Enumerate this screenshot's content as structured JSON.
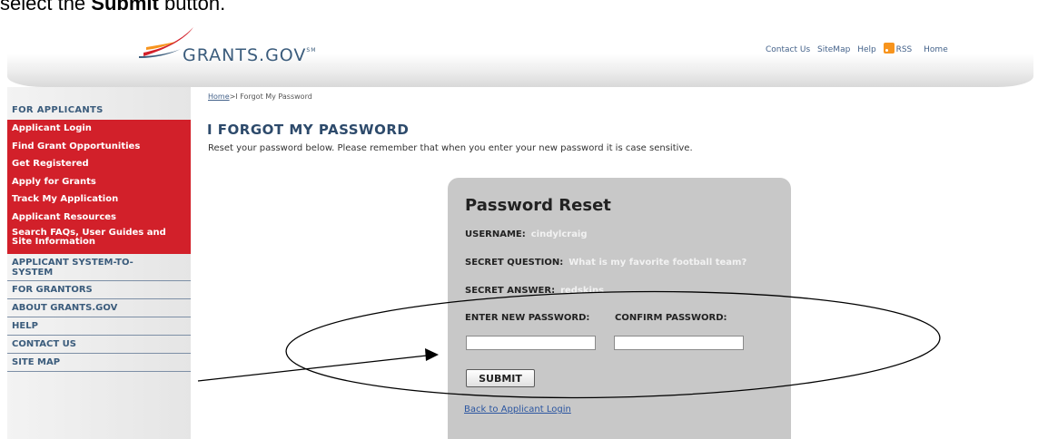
{
  "caption": {
    "prefix": "select the ",
    "bold": "Submit",
    "suffix": " button."
  },
  "header": {
    "logo_text": "GRANTS.GOV",
    "logo_mark": "SM",
    "toplinks": {
      "contact": "Contact Us",
      "sitemap": "SiteMap",
      "help": "Help",
      "rss": "RSS",
      "home": "Home"
    }
  },
  "sidebar": {
    "heading": "FOR APPLICANTS",
    "red_items": [
      "Applicant Login",
      "Find Grant Opportunities",
      "Get Registered",
      "Apply for Grants",
      "Track My Application",
      "Applicant Resources",
      "Search FAQs, User Guides and",
      "Site Information"
    ],
    "gray_items": [
      "APPLICANT SYSTEM-TO-",
      "SYSTEM",
      "FOR GRANTORS",
      "ABOUT GRANTS.GOV",
      "HELP",
      "CONTACT US",
      "SITE MAP"
    ]
  },
  "breadcrumb": {
    "home": "Home",
    "separator": ">",
    "current": "I Forgot My Password"
  },
  "page": {
    "title": "I FORGOT MY PASSWORD",
    "intro": "Reset your password below. Please remember that when you enter your new password it is case sensitive."
  },
  "form": {
    "title": "Password Reset",
    "username_label": "USERNAME:",
    "username_value": "cindylcraig",
    "question_label": "SECRET QUESTION:",
    "question_value": "What is my favorite football team?",
    "answer_label": "SECRET ANSWER:",
    "answer_value": "redskins",
    "new_password_label": "ENTER NEW PASSWORD:",
    "confirm_password_label": "CONFIRM PASSWORD:",
    "new_password_value": "",
    "confirm_password_value": "",
    "submit_label": "SUBMIT",
    "back_link": "Back to Applicant Login"
  },
  "colors": {
    "sidebar_red": "#d2202a",
    "brand_blue": "#3b5c7c",
    "panel_gray": "#c8c8c8",
    "rss_orange": "#f7941d"
  }
}
